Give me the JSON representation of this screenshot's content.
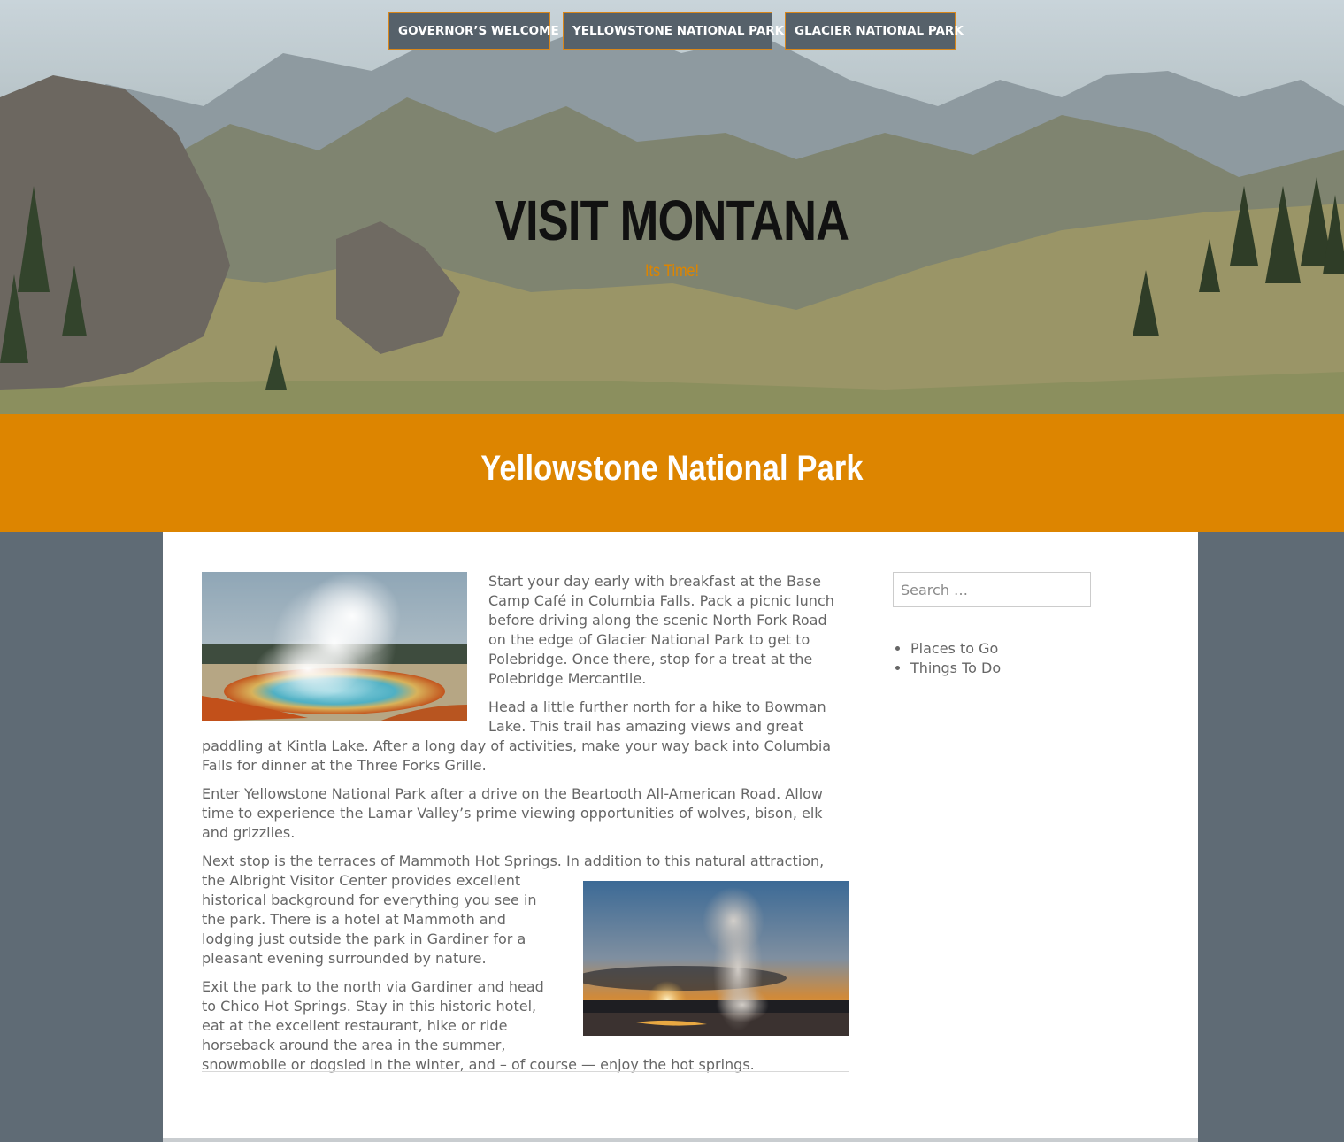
{
  "nav": {
    "items": [
      {
        "label": "GOVERNOR’S WELCOME"
      },
      {
        "label": "YELLOWSTONE NATIONAL PARK"
      },
      {
        "label": "GLACIER NATIONAL PARK"
      }
    ]
  },
  "site": {
    "title": "VISIT MONTANA",
    "tagline": "Its Time!"
  },
  "page": {
    "title": "Yellowstone National Park"
  },
  "article": {
    "paragraphs": [
      "Start your day early with breakfast at the Base Camp Café in Columbia Falls. Pack a picnic lunch before driving along the scenic North Fork Road on the edge of Glacier National Park to get to Polebridge. Once there, stop for a treat at the Polebridge Mercantile.",
      "Head a little further north for a hike to Bowman Lake. This trail has amazing views and great paddling at Kintla Lake. After a long day of activities,  make your way back into Columbia Falls for dinner at the Three Forks Grille.",
      "Enter Yellowstone National Park after a drive on the Beartooth All-American Road.  Allow time to experience the Lamar Valley’s prime viewing opportunities of wolves, bison, elk and grizzlies.",
      "Next stop is the terraces of Mammoth Hot Springs. In addition to this natural attraction, the Albright Visitor Center provides excellent historical background for everything you see in the park. There is a hotel at Mammoth and lodging just outside the park in Gardiner for a pleasant evening surrounded by nature.",
      "Exit  the park to the north via Gardiner and head to Chico Hot Springs. Stay in this historic hotel, eat at the excellent restaurant, hike or ride horseback around the area in the summer, snowmobile or dogsled in the winter, and – of course — enjoy the hot springs."
    ]
  },
  "sidebar": {
    "search_placeholder": "Search …",
    "links": [
      {
        "label": "Places to Go"
      },
      {
        "label": "Things To Do"
      }
    ]
  },
  "colors": {
    "accent": "#dd8500",
    "nav_bg": "#56616a",
    "page_bg": "#5f6b75"
  }
}
